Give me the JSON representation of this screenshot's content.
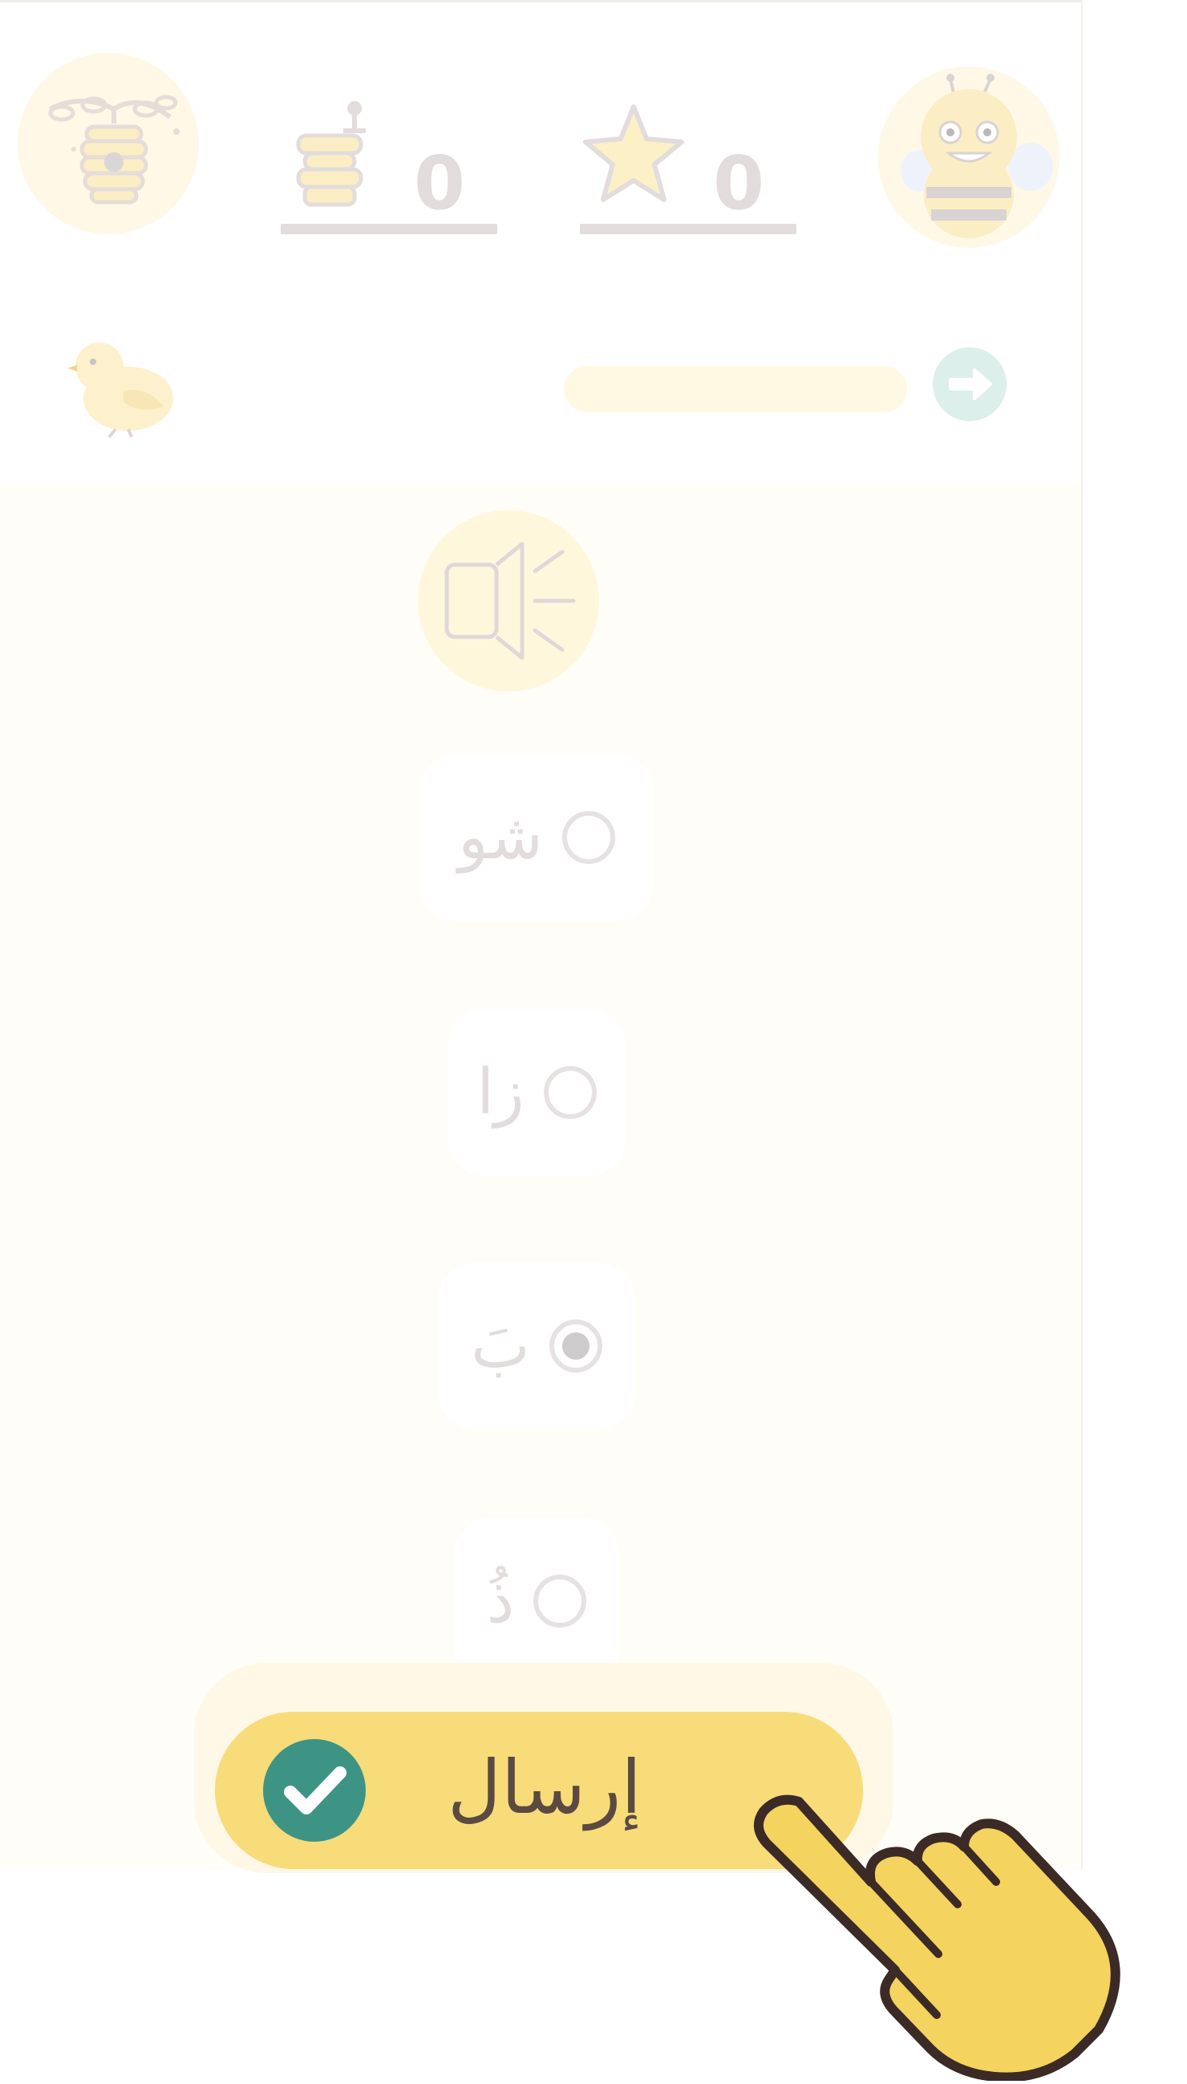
{
  "header": {
    "honey_count": "0",
    "star_count": "0",
    "icons": {
      "hive": "beehive-icon",
      "honey": "honey-jar-icon",
      "star": "star-icon",
      "bee": "bee-avatar-icon"
    }
  },
  "progress": {
    "value": 0,
    "chick_icon": "chick-icon",
    "next_icon": "arrow-right-icon"
  },
  "question": {
    "audio_icon": "speaker-icon"
  },
  "options": [
    {
      "label": "شو",
      "selected": false
    },
    {
      "label": "زا",
      "selected": false
    },
    {
      "label": "بَ",
      "selected": true
    },
    {
      "label": "ذُ",
      "selected": false
    }
  ],
  "submit": {
    "label": "إرسال",
    "icon": "checkmark-icon"
  },
  "overlay": {
    "hand_icon": "pointing-hand-icon"
  },
  "colors": {
    "background": "#fffdf7",
    "accent_yellow": "#f7dc79",
    "accent_teal": "#3d9485",
    "muted_text": "#e2dcdc",
    "submit_text": "#5b4a42"
  }
}
